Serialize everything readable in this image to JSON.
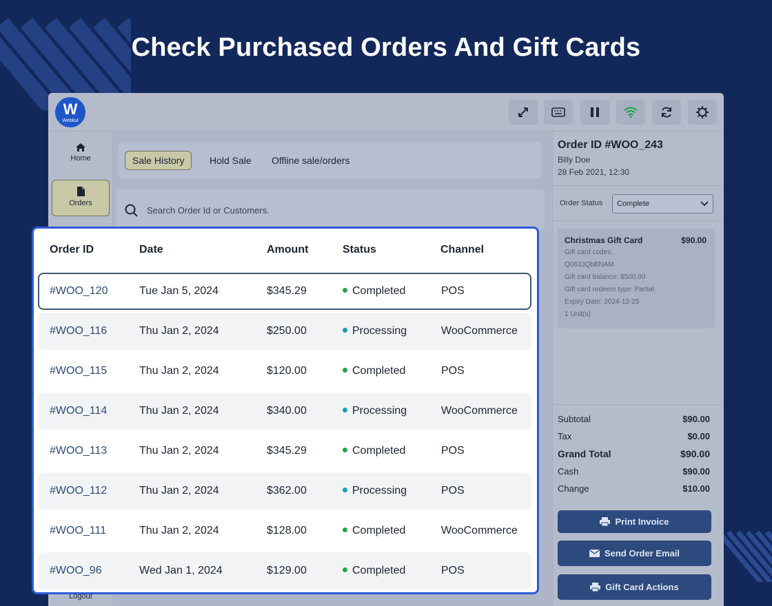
{
  "headline": "Check Purchased Orders And Gift Cards",
  "app": {
    "logo_text": "W",
    "logo_caption": "Webkul",
    "toolbar": [
      {
        "icon": "expand-icon"
      },
      {
        "icon": "keyboard-icon"
      },
      {
        "icon": "pause-icon"
      },
      {
        "icon": "wifi-icon",
        "color": "#16a34a"
      },
      {
        "icon": "refresh-icon"
      },
      {
        "icon": "gear-icon"
      }
    ]
  },
  "sidebar": {
    "items": [
      {
        "label": "Home",
        "icon": "home-icon"
      },
      {
        "label": "Orders",
        "icon": "document-icon"
      }
    ],
    "logout_label": "Logout"
  },
  "tabs": [
    {
      "label": "Sale History",
      "active": true
    },
    {
      "label": "Hold Sale",
      "active": false
    },
    {
      "label": "Offline sale/orders",
      "active": false
    }
  ],
  "search": {
    "placeholder": "Search Order Id or Customers."
  },
  "table": {
    "headers": [
      "Order ID",
      "Date",
      "Amount",
      "Status",
      "Channel"
    ],
    "rows": [
      {
        "id": "#WOO_120",
        "date": "Tue Jan 5, 2024",
        "amount": "$345.29",
        "status": "Completed",
        "channel": "POS"
      },
      {
        "id": "#WOO_116",
        "date": "Thu Jan 2, 2024",
        "amount": "$250.00",
        "status": "Processing",
        "channel": "WooCommerce"
      },
      {
        "id": "#WOO_115",
        "date": "Thu Jan 2, 2024",
        "amount": "$120.00",
        "status": "Completed",
        "channel": "POS"
      },
      {
        "id": "#WOO_114",
        "date": "Thu Jan 2, 2024",
        "amount": "$340.00",
        "status": "Processing",
        "channel": "WooCommerce"
      },
      {
        "id": "#WOO_113",
        "date": "Thu Jan 2, 2024",
        "amount": "$345.29",
        "status": "Completed",
        "channel": "POS"
      },
      {
        "id": "#WOO_112",
        "date": "Thu Jan 2, 2024",
        "amount": "$362.00",
        "status": "Processing",
        "channel": "POS"
      },
      {
        "id": "#WOO_111",
        "date": "Thu Jan 2, 2024",
        "amount": "$128.00",
        "status": "Completed",
        "channel": "WooCommerce"
      },
      {
        "id": "#WOO_96",
        "date": "Wed Jan 1, 2024",
        "amount": "$129.00",
        "status": "Completed",
        "channel": "POS"
      }
    ],
    "selected_row": 0,
    "status_colors": {
      "Completed": "#22a447",
      "Processing": "#1e9bb0"
    }
  },
  "order_detail": {
    "title": "Order ID #WOO_243",
    "customer": "Billy Doe",
    "datetime": "28 Feb 2021, 12:30",
    "status_label": "Order Status",
    "status_value": "Complete",
    "item": {
      "name": "Christmas Gift Card",
      "price": "$90.00",
      "lines": [
        "Gift card codes:",
        "Q063JQbBNAM",
        "Gift card balance: $500.00",
        "Gift card redeem type: Partial",
        "Expiry Date: 2024-12-25",
        "1 Unit(s)"
      ]
    },
    "totals": [
      {
        "label": "Subtotal",
        "value": "$90.00",
        "bold": false
      },
      {
        "label": "Tax",
        "value": "$0.00",
        "bold": false
      },
      {
        "label": "Grand Total",
        "value": "$90.00",
        "bold": true
      },
      {
        "label": "Cash",
        "value": "$90.00",
        "bold": false
      },
      {
        "label": "Change",
        "value": "$10.00",
        "bold": false
      }
    ],
    "actions": [
      {
        "label": "Print Invoice",
        "icon": "printer-icon"
      },
      {
        "label": "Send Order Email",
        "icon": "envelope-icon"
      },
      {
        "label": "Gift Card Actions",
        "icon": "printer-icon"
      }
    ]
  },
  "colors": {
    "background": "#13285a",
    "accent": "#2f5bd8",
    "button": "#2c4a7e"
  }
}
